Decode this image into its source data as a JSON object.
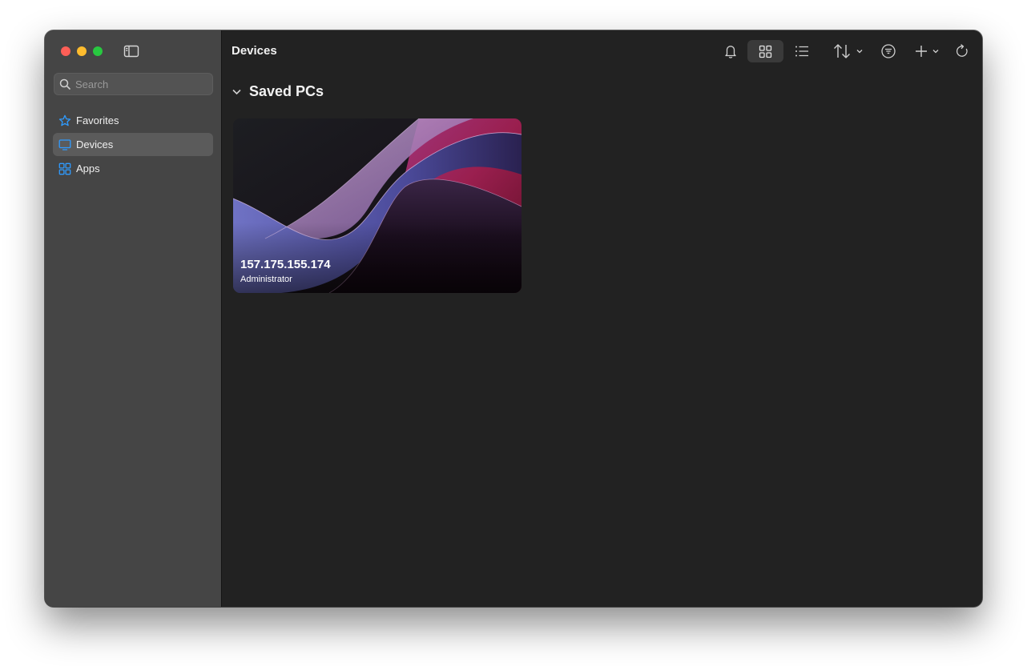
{
  "search": {
    "placeholder": "Search"
  },
  "sidebar": {
    "items": [
      {
        "label": "Favorites",
        "icon": "star-icon",
        "selected": false
      },
      {
        "label": "Devices",
        "icon": "monitor-icon",
        "selected": true
      },
      {
        "label": "Apps",
        "icon": "apps-icon",
        "selected": false
      }
    ]
  },
  "header": {
    "title": "Devices"
  },
  "toolbar": {
    "icons": [
      "bell-icon",
      "grid-view-icon",
      "list-view-icon",
      "sort-icon",
      "chevron-down-icon",
      "filter-icon",
      "plus-icon",
      "chevron-down-icon",
      "refresh-icon"
    ],
    "active_view": "grid"
  },
  "section": {
    "title": "Saved PCs",
    "expanded": true
  },
  "pcs": [
    {
      "host": "157.175.155.174",
      "user": "Administrator"
    }
  ],
  "colors": {
    "accent": "#2f9bff",
    "sidebar_bg": "#454545",
    "content_bg": "#222222",
    "traffic_close": "#fe5f57",
    "traffic_minimize": "#febc2e",
    "traffic_maximize": "#28c840"
  }
}
